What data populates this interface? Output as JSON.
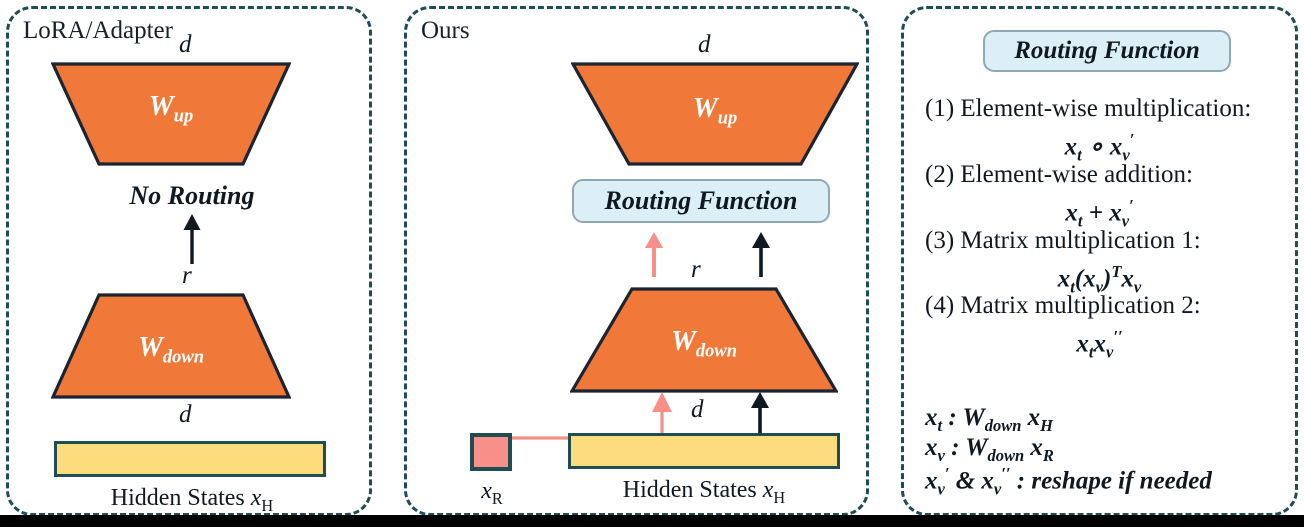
{
  "figure": {
    "panels": [
      {
        "id": "lora",
        "title": "LoRA/Adapter",
        "top_dim": "d",
        "mid_dim": "r",
        "bottom_dim": "d",
        "up_block": "W",
        "up_sub": "up",
        "down_block": "W",
        "down_sub": "down",
        "routing_text": "No Routing",
        "hidden_caption": "Hidden States",
        "hidden_symbol": "x",
        "hidden_sub": "H"
      },
      {
        "id": "ours",
        "title": "Ours",
        "top_dim": "d",
        "mid_dim": "r",
        "bottom_dim": "d",
        "up_block": "W",
        "up_sub": "up",
        "down_block": "W",
        "down_sub": "down",
        "routing_text": "Routing Function",
        "hidden_caption": "Hidden States",
        "hidden_symbol": "x",
        "hidden_sub": "H",
        "router_symbol": "x",
        "router_sub": "R"
      }
    ],
    "routing_panel": {
      "header": "Routing Function",
      "items": [
        {
          "index": "(1)",
          "label": "Element-wise multiplication:",
          "formula_html": "<i>x</i><sub>t</sub> ∘ <i>x</i><sub>v</sub><sup>′</sup>"
        },
        {
          "index": "(2)",
          "label": "Element-wise addition:",
          "formula_html": "<i>x</i><sub>t</sub> + <i>x</i><sub>v</sub><sup>′</sup>"
        },
        {
          "index": "(3)",
          "label": "Matrix multiplication 1:",
          "formula_html": "<i>x</i><sub>t</sub>(<i>x</i><sub>v</sub>)<sup>T</sup><i>x</i><sub>v</sub>"
        },
        {
          "index": "(4)",
          "label": "Matrix multiplication 2:",
          "formula_html": "<i>x</i><sub>t</sub><i>x</i><sub>v</sub><sup>′′</sup>"
        }
      ],
      "definitions": [
        "x_t : W_down x_H",
        "x_v : W_down x_R",
        "x_v' & x_v'' : reshape if needed"
      ],
      "definitions_html": [
        "<i>x</i><sub>t</sub> : <i>W</i><sub>down</sub> <i>x</i><sub>H</sub>",
        "<i>x</i><sub>v</sub> : <i>W</i><sub>down</sub> <i>x</i><sub>R</sub>",
        "<i>x</i><sub>v</sub><sup>′</sup> &amp; <i>x</i><sub>v</sub><sup>′′</sup> : reshape if needed"
      ]
    },
    "colors": {
      "trapezoid_fill": "#f07838",
      "trapezoid_stroke": "#1b2430",
      "hidden_bar_fill": "#fcdc7c",
      "hidden_bar_stroke": "#1f4e52",
      "router_box_fill": "#f79088",
      "router_box_stroke": "#1f4e52",
      "pill_fill": "#dceef6",
      "pill_stroke": "#8fa9b4",
      "panel_border": "#1f4e52",
      "arrow_black": "#101820",
      "arrow_pink": "#f79088",
      "text": "#101820"
    }
  }
}
